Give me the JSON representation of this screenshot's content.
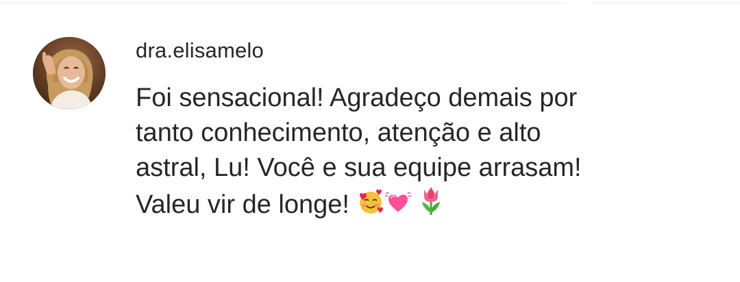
{
  "comment": {
    "username": "dra.elisamelo",
    "text_lines": [
      "Foi sensacional! Agradeço demais por",
      "tanto conhecimento, atenção e alto",
      "astral, Lu! Você e sua equipe arrasam!",
      "Valeu vir de longe!"
    ],
    "emojis": [
      "smiling-face-with-hearts-icon",
      "growing-heart-icon",
      "tulip-icon"
    ]
  },
  "colors": {
    "text": "#262626",
    "divider": "#e8e8e8"
  }
}
